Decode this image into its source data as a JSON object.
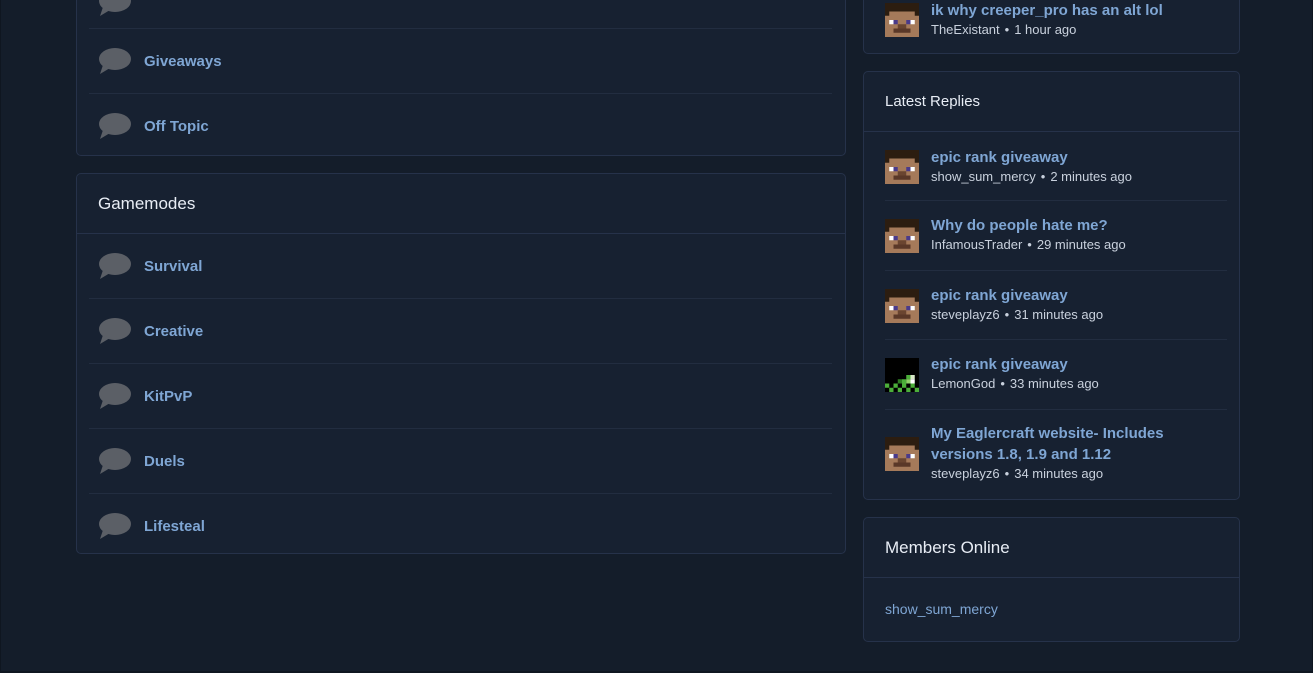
{
  "forum_top": {
    "nodes": [
      {
        "title": "Giveaways"
      },
      {
        "title": "Off Topic"
      }
    ]
  },
  "gamemodes": {
    "header": "Gamemodes",
    "nodes": [
      {
        "title": "Survival"
      },
      {
        "title": "Creative"
      },
      {
        "title": "KitPvP"
      },
      {
        "title": "Duels"
      },
      {
        "title": "Lifesteal"
      }
    ]
  },
  "latest_posts": {
    "partial_item": {
      "title": "ik why creeper_pro has an alt lol",
      "user": "TheExistant",
      "time": "1 hour ago",
      "avatar": "steve"
    }
  },
  "latest_replies": {
    "header": "Latest Replies",
    "items": [
      {
        "title": "epic rank giveaway",
        "user": "show_sum_mercy",
        "time": "2 minutes ago",
        "avatar": "steve"
      },
      {
        "title": "Why do people hate me?",
        "user": "InfamousTrader",
        "time": "29 minutes ago",
        "avatar": "steve"
      },
      {
        "title": "epic rank giveaway",
        "user": "steveplayz6",
        "time": "31 minutes ago",
        "avatar": "steve"
      },
      {
        "title": "epic rank giveaway",
        "user": "LemonGod",
        "time": "33 minutes ago",
        "avatar": "creeper-dark"
      },
      {
        "title": "My Eaglercraft website- Includes versions 1.8, 1.9 and 1.12",
        "user": "steveplayz6",
        "time": "34 minutes ago",
        "avatar": "steve"
      }
    ]
  },
  "members_online": {
    "header": "Members Online",
    "members": [
      "show_sum_mercy"
    ]
  },
  "separator": "•",
  "colors": {
    "background": "#141d2a",
    "panel": "#172131",
    "border": "#26324a",
    "link": "#7fa6d4",
    "icon": "#5b5f66"
  }
}
